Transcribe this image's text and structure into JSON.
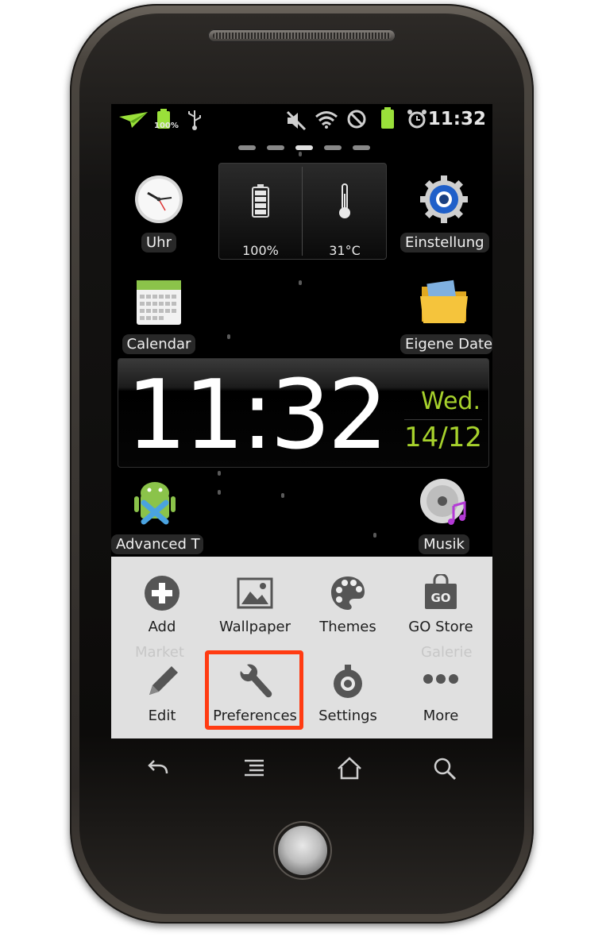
{
  "statusbar": {
    "battery_percent": "100%",
    "time": "11:32",
    "icons": [
      "notification-plane-icon",
      "battery-icon",
      "usb-icon",
      "mute-icon",
      "wifi-icon",
      "blocked-icon",
      "battery-full-icon",
      "alarm-icon"
    ]
  },
  "home": {
    "page_count": 5,
    "active_page": 2,
    "apps": [
      {
        "label": "Uhr",
        "icon": "clock-icon"
      },
      {
        "label": "Einstellung",
        "icon": "settings-gear-icon"
      },
      {
        "label": "Calendar",
        "icon": "calendar-icon"
      },
      {
        "label": "Eigene Date",
        "icon": "folder-icon"
      },
      {
        "label": "Advanced T",
        "icon": "android-task-killer-icon"
      },
      {
        "label": "Musik",
        "icon": "music-cd-icon"
      }
    ],
    "status_widget": {
      "battery": "100%",
      "temperature": "31°C"
    },
    "clock_widget": {
      "time": "11:32",
      "day": "Wed.",
      "date": "14/12"
    }
  },
  "menu": {
    "items": [
      {
        "label": "Add",
        "icon": "add-icon"
      },
      {
        "label": "Wallpaper",
        "icon": "wallpaper-icon"
      },
      {
        "label": "Themes",
        "icon": "palette-icon"
      },
      {
        "label": "GO Store",
        "icon": "go-store-icon"
      },
      {
        "label": "Edit",
        "icon": "pencil-icon"
      },
      {
        "label": "Preferences",
        "icon": "wrench-icon"
      },
      {
        "label": "Settings",
        "icon": "settings-icon"
      },
      {
        "label": "More",
        "icon": "more-dots-icon"
      }
    ],
    "ghost_labels": [
      "Market",
      "Galerie"
    ],
    "highlight_color": "#ff3b12"
  },
  "colors": {
    "accent_green": "#a6d12c"
  }
}
